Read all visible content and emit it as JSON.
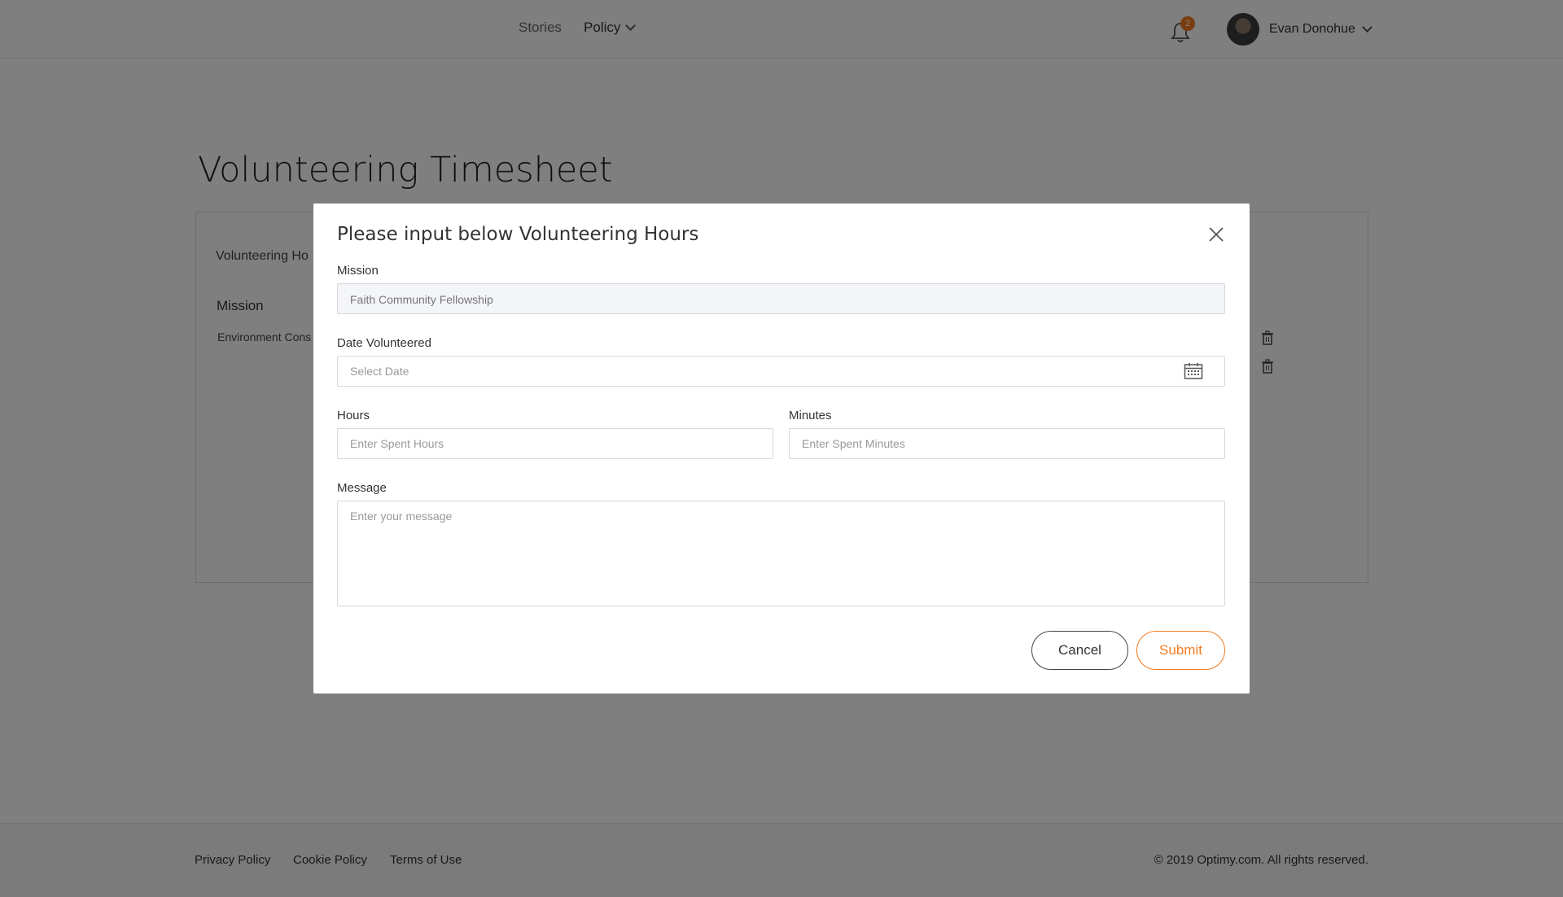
{
  "header": {
    "nav": {
      "stories": "Stories",
      "policy": "Policy"
    },
    "notifications_count": "2",
    "user_name": "Evan Donohue"
  },
  "page": {
    "title": "Volunteering Timesheet",
    "panel_heading": "Volunteering Ho",
    "column_mission": "Mission",
    "row_mission": "Environment Cons"
  },
  "modal": {
    "title": "Please input below Volunteering Hours",
    "mission_label": "Mission",
    "mission_value": "Faith Community  Fellowship",
    "date_label": "Date Volunteered",
    "date_placeholder": "Select Date",
    "hours_label": "Hours",
    "hours_placeholder": "Enter Spent Hours",
    "minutes_label": "Minutes",
    "minutes_placeholder": "Enter Spent Minutes",
    "message_label": "Message",
    "message_placeholder": "Enter your message",
    "cancel_label": "Cancel",
    "submit_label": "Submit"
  },
  "footer": {
    "privacy": "Privacy Policy",
    "cookie": "Cookie Policy",
    "terms": "Terms of Use",
    "copyright": "© 2019 Optimy.com. All rights reserved."
  },
  "colors": {
    "accent": "#f47b20",
    "overlay": "rgba(0,0,0,0.5)"
  },
  "icons": [
    "bell-icon",
    "chevron-down-icon",
    "close-icon",
    "calendar-icon",
    "trash-icon"
  ]
}
